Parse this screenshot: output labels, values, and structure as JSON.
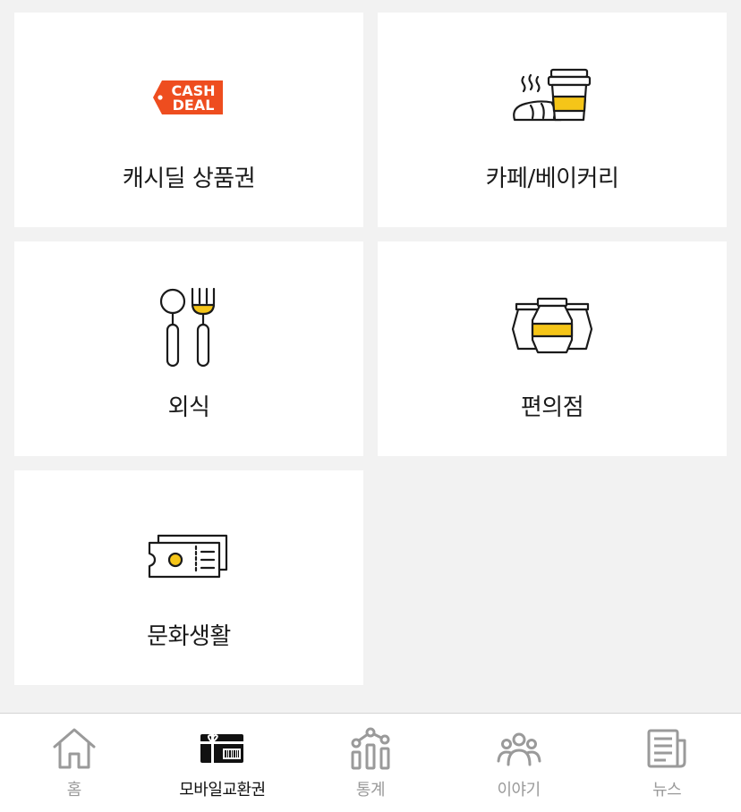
{
  "categories": [
    {
      "label": "캐시딜 상품권",
      "icon": "cashdeal-tag-icon",
      "badge_text": [
        "CASH",
        "DEAL"
      ]
    },
    {
      "label": "카페/베이커리",
      "icon": "coffee-bread-icon"
    },
    {
      "label": "외식",
      "icon": "spoon-fork-icon"
    },
    {
      "label": "편의점",
      "icon": "jars-icon"
    },
    {
      "label": "문화생활",
      "icon": "ticket-icon"
    }
  ],
  "tabs": [
    {
      "label": "홈",
      "icon": "home-icon",
      "active": false
    },
    {
      "label": "모바일교환권",
      "icon": "gift-card-icon",
      "active": true
    },
    {
      "label": "통계",
      "icon": "stats-icon",
      "active": false
    },
    {
      "label": "이야기",
      "icon": "community-icon",
      "active": false
    },
    {
      "label": "뉴스",
      "icon": "news-icon",
      "active": false
    }
  ],
  "colors": {
    "background": "#f2f2f2",
    "card": "#ffffff",
    "accent_yellow": "#f5c518",
    "cashdeal_orange": "#ee4d1f",
    "tab_inactive": "#9a9a9a",
    "tab_active": "#111111"
  }
}
